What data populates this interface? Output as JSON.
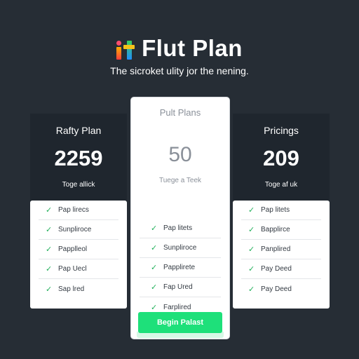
{
  "header": {
    "logo_icon": "it-logo-icon",
    "title": "Flut Plan",
    "subtitle": "The sicroket ulity jor the nening."
  },
  "plans": [
    {
      "name": "Rafty Plan",
      "price": "2259",
      "tagline": "Toge allick",
      "features": [
        "Pap lirecs",
        "Sunpliroce",
        "Papplleol",
        "Pap Uecl",
        "Sap lred"
      ]
    },
    {
      "name": "Pult Plans",
      "price": "50",
      "tagline": "Tuege a Teek",
      "features": [
        "Pap litets",
        "Sunpliroce",
        "Papplirete",
        "Fap Ured",
        "Farplired"
      ],
      "cta_label": "Begin Palast"
    },
    {
      "name": "Pricings",
      "price": "209",
      "tagline": "Toge af uk",
      "features": [
        "Pap litets",
        "Bapplirce",
        "Panplired",
        "Pay Deed",
        "Pay Deed"
      ]
    }
  ],
  "colors": {
    "background": "#262d35",
    "dark_card": "#1f262e",
    "accent_green": "#1ee07a",
    "check_green": "#21b05a"
  }
}
